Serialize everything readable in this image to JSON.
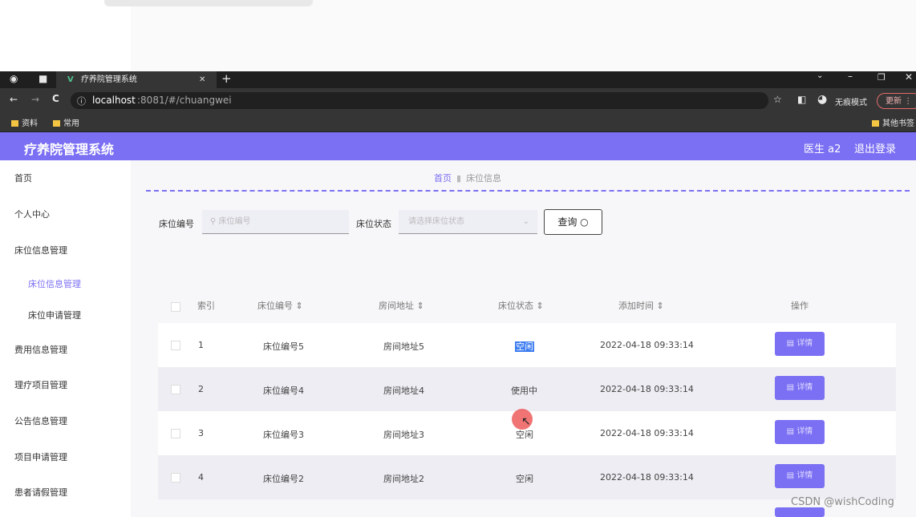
{
  "browser": {
    "tab_title": "疗养院管理系统",
    "url_host": "localhost",
    "url_rest": ":8081/#/chuangwei",
    "incognito_label": "无痕模式",
    "update_label": "更新",
    "bookmarks": [
      "资料",
      "常用"
    ],
    "other_bookmarks": "其他书签"
  },
  "app": {
    "title": "疗养院管理系统",
    "user": "医生 a2",
    "logout": "退出登录"
  },
  "sidebar": {
    "items": [
      {
        "label": "首页"
      },
      {
        "label": "个人中心"
      },
      {
        "label": "床位信息管理"
      },
      {
        "label": "床位信息管理",
        "active": true
      },
      {
        "label": "床位申请管理"
      },
      {
        "label": "费用信息管理"
      },
      {
        "label": "理疗项目管理"
      },
      {
        "label": "公告信息管理"
      },
      {
        "label": "项目申请管理"
      },
      {
        "label": "患者请假管理"
      }
    ]
  },
  "breadcrumb": {
    "home": "首页",
    "current": "床位信息"
  },
  "filters": {
    "bed_no_label": "床位编号",
    "bed_no_placeholder": "床位编号",
    "status_label": "床位状态",
    "status_placeholder": "请选择床位状态",
    "search_button": "查询"
  },
  "table": {
    "headers": [
      "索引",
      "床位编号",
      "房间地址",
      "床位状态",
      "添加时间",
      "操作"
    ],
    "rows": [
      {
        "index": "1",
        "bed_no": "床位编号5",
        "room": "房间地址5",
        "status": "空闲",
        "time": "2022-04-18 09:33:14",
        "action": "详情"
      },
      {
        "index": "2",
        "bed_no": "床位编号4",
        "room": "房间地址4",
        "status": "使用中",
        "time": "2022-04-18 09:33:14",
        "action": "详情"
      },
      {
        "index": "3",
        "bed_no": "床位编号3",
        "room": "房间地址3",
        "status": "空闲",
        "time": "2022-04-18 09:33:14",
        "action": "详情"
      },
      {
        "index": "4",
        "bed_no": "床位编号2",
        "room": "房间地址2",
        "status": "空闲",
        "time": "2022-04-18 09:33:14",
        "action": "详情"
      }
    ]
  },
  "watermark": "CSDN @wishCoding",
  "colors": {
    "accent": "#7b6ff3",
    "chrome": "#353535"
  }
}
